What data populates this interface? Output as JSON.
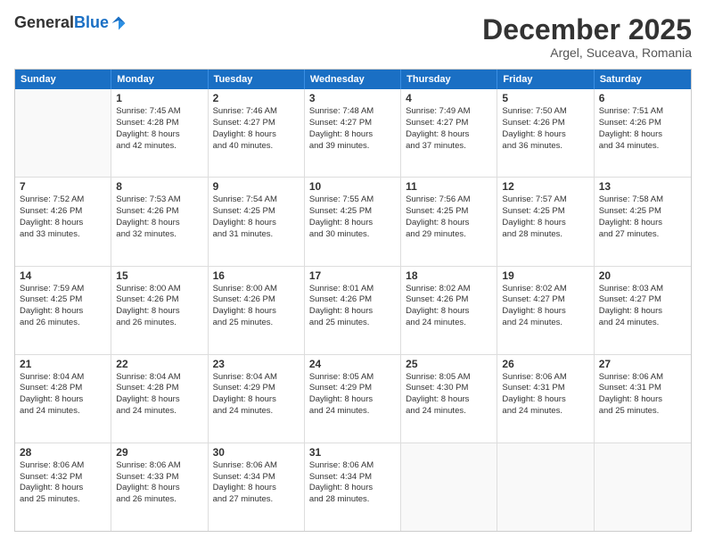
{
  "header": {
    "logo_general": "General",
    "logo_blue": "Blue",
    "month_title": "December 2025",
    "location": "Argel, Suceava, Romania"
  },
  "days_of_week": [
    "Sunday",
    "Monday",
    "Tuesday",
    "Wednesday",
    "Thursday",
    "Friday",
    "Saturday"
  ],
  "weeks": [
    [
      {
        "day": "",
        "empty": true
      },
      {
        "day": "1",
        "sunrise": "Sunrise: 7:45 AM",
        "sunset": "Sunset: 4:28 PM",
        "daylight": "Daylight: 8 hours and 42 minutes."
      },
      {
        "day": "2",
        "sunrise": "Sunrise: 7:46 AM",
        "sunset": "Sunset: 4:27 PM",
        "daylight": "Daylight: 8 hours and 40 minutes."
      },
      {
        "day": "3",
        "sunrise": "Sunrise: 7:48 AM",
        "sunset": "Sunset: 4:27 PM",
        "daylight": "Daylight: 8 hours and 39 minutes."
      },
      {
        "day": "4",
        "sunrise": "Sunrise: 7:49 AM",
        "sunset": "Sunset: 4:27 PM",
        "daylight": "Daylight: 8 hours and 37 minutes."
      },
      {
        "day": "5",
        "sunrise": "Sunrise: 7:50 AM",
        "sunset": "Sunset: 4:26 PM",
        "daylight": "Daylight: 8 hours and 36 minutes."
      },
      {
        "day": "6",
        "sunrise": "Sunrise: 7:51 AM",
        "sunset": "Sunset: 4:26 PM",
        "daylight": "Daylight: 8 hours and 34 minutes."
      }
    ],
    [
      {
        "day": "7",
        "sunrise": "Sunrise: 7:52 AM",
        "sunset": "Sunset: 4:26 PM",
        "daylight": "Daylight: 8 hours and 33 minutes."
      },
      {
        "day": "8",
        "sunrise": "Sunrise: 7:53 AM",
        "sunset": "Sunset: 4:26 PM",
        "daylight": "Daylight: 8 hours and 32 minutes."
      },
      {
        "day": "9",
        "sunrise": "Sunrise: 7:54 AM",
        "sunset": "Sunset: 4:25 PM",
        "daylight": "Daylight: 8 hours and 31 minutes."
      },
      {
        "day": "10",
        "sunrise": "Sunrise: 7:55 AM",
        "sunset": "Sunset: 4:25 PM",
        "daylight": "Daylight: 8 hours and 30 minutes."
      },
      {
        "day": "11",
        "sunrise": "Sunrise: 7:56 AM",
        "sunset": "Sunset: 4:25 PM",
        "daylight": "Daylight: 8 hours and 29 minutes."
      },
      {
        "day": "12",
        "sunrise": "Sunrise: 7:57 AM",
        "sunset": "Sunset: 4:25 PM",
        "daylight": "Daylight: 8 hours and 28 minutes."
      },
      {
        "day": "13",
        "sunrise": "Sunrise: 7:58 AM",
        "sunset": "Sunset: 4:25 PM",
        "daylight": "Daylight: 8 hours and 27 minutes."
      }
    ],
    [
      {
        "day": "14",
        "sunrise": "Sunrise: 7:59 AM",
        "sunset": "Sunset: 4:25 PM",
        "daylight": "Daylight: 8 hours and 26 minutes."
      },
      {
        "day": "15",
        "sunrise": "Sunrise: 8:00 AM",
        "sunset": "Sunset: 4:26 PM",
        "daylight": "Daylight: 8 hours and 26 minutes."
      },
      {
        "day": "16",
        "sunrise": "Sunrise: 8:00 AM",
        "sunset": "Sunset: 4:26 PM",
        "daylight": "Daylight: 8 hours and 25 minutes."
      },
      {
        "day": "17",
        "sunrise": "Sunrise: 8:01 AM",
        "sunset": "Sunset: 4:26 PM",
        "daylight": "Daylight: 8 hours and 25 minutes."
      },
      {
        "day": "18",
        "sunrise": "Sunrise: 8:02 AM",
        "sunset": "Sunset: 4:26 PM",
        "daylight": "Daylight: 8 hours and 24 minutes."
      },
      {
        "day": "19",
        "sunrise": "Sunrise: 8:02 AM",
        "sunset": "Sunset: 4:27 PM",
        "daylight": "Daylight: 8 hours and 24 minutes."
      },
      {
        "day": "20",
        "sunrise": "Sunrise: 8:03 AM",
        "sunset": "Sunset: 4:27 PM",
        "daylight": "Daylight: 8 hours and 24 minutes."
      }
    ],
    [
      {
        "day": "21",
        "sunrise": "Sunrise: 8:04 AM",
        "sunset": "Sunset: 4:28 PM",
        "daylight": "Daylight: 8 hours and 24 minutes."
      },
      {
        "day": "22",
        "sunrise": "Sunrise: 8:04 AM",
        "sunset": "Sunset: 4:28 PM",
        "daylight": "Daylight: 8 hours and 24 minutes."
      },
      {
        "day": "23",
        "sunrise": "Sunrise: 8:04 AM",
        "sunset": "Sunset: 4:29 PM",
        "daylight": "Daylight: 8 hours and 24 minutes."
      },
      {
        "day": "24",
        "sunrise": "Sunrise: 8:05 AM",
        "sunset": "Sunset: 4:29 PM",
        "daylight": "Daylight: 8 hours and 24 minutes."
      },
      {
        "day": "25",
        "sunrise": "Sunrise: 8:05 AM",
        "sunset": "Sunset: 4:30 PM",
        "daylight": "Daylight: 8 hours and 24 minutes."
      },
      {
        "day": "26",
        "sunrise": "Sunrise: 8:06 AM",
        "sunset": "Sunset: 4:31 PM",
        "daylight": "Daylight: 8 hours and 24 minutes."
      },
      {
        "day": "27",
        "sunrise": "Sunrise: 8:06 AM",
        "sunset": "Sunset: 4:31 PM",
        "daylight": "Daylight: 8 hours and 25 minutes."
      }
    ],
    [
      {
        "day": "28",
        "sunrise": "Sunrise: 8:06 AM",
        "sunset": "Sunset: 4:32 PM",
        "daylight": "Daylight: 8 hours and 25 minutes."
      },
      {
        "day": "29",
        "sunrise": "Sunrise: 8:06 AM",
        "sunset": "Sunset: 4:33 PM",
        "daylight": "Daylight: 8 hours and 26 minutes."
      },
      {
        "day": "30",
        "sunrise": "Sunrise: 8:06 AM",
        "sunset": "Sunset: 4:34 PM",
        "daylight": "Daylight: 8 hours and 27 minutes."
      },
      {
        "day": "31",
        "sunrise": "Sunrise: 8:06 AM",
        "sunset": "Sunset: 4:34 PM",
        "daylight": "Daylight: 8 hours and 28 minutes."
      },
      {
        "day": "",
        "empty": true
      },
      {
        "day": "",
        "empty": true
      },
      {
        "day": "",
        "empty": true
      }
    ]
  ]
}
